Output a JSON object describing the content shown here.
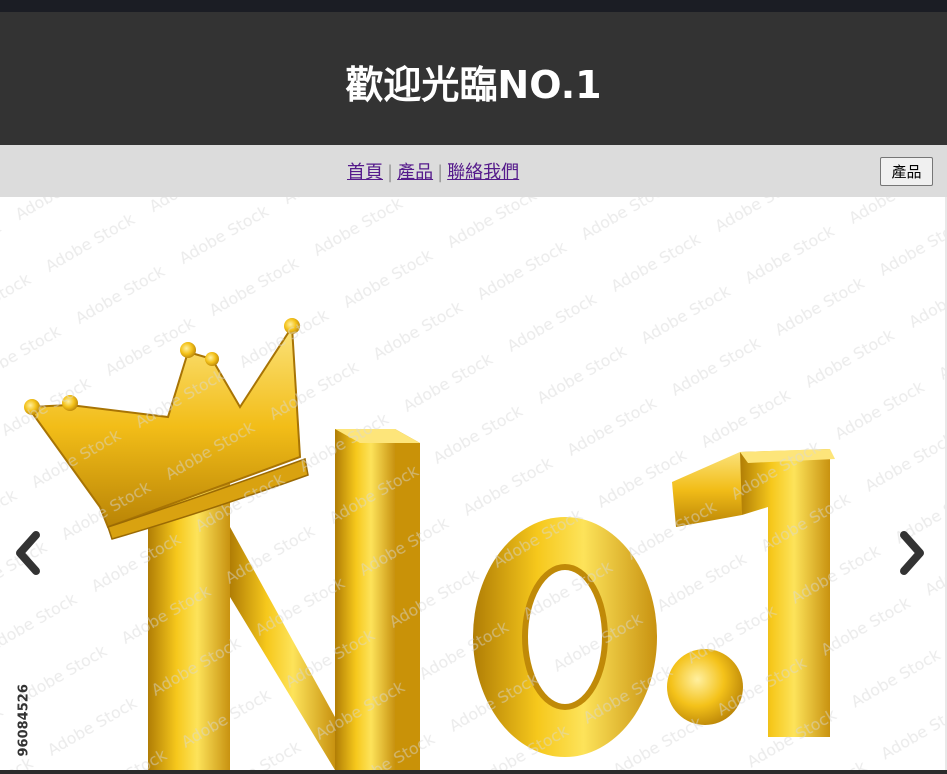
{
  "header": {
    "title": "歡迎光臨NO.1"
  },
  "nav": {
    "links": [
      "首頁",
      "產品",
      "聯絡我們"
    ],
    "separator": "|",
    "button_label": "產品"
  },
  "slider": {
    "image_alt": "No.1 gold crown",
    "stock_id": "96084526",
    "watermark": "Adobe Stock",
    "prev_icon": "chevron-left-icon",
    "next_icon": "chevron-right-icon"
  },
  "colors": {
    "header_bg": "#333333",
    "nav_bg": "#dcdcdc",
    "gold": "#e8b410",
    "link": "#551a8b"
  }
}
